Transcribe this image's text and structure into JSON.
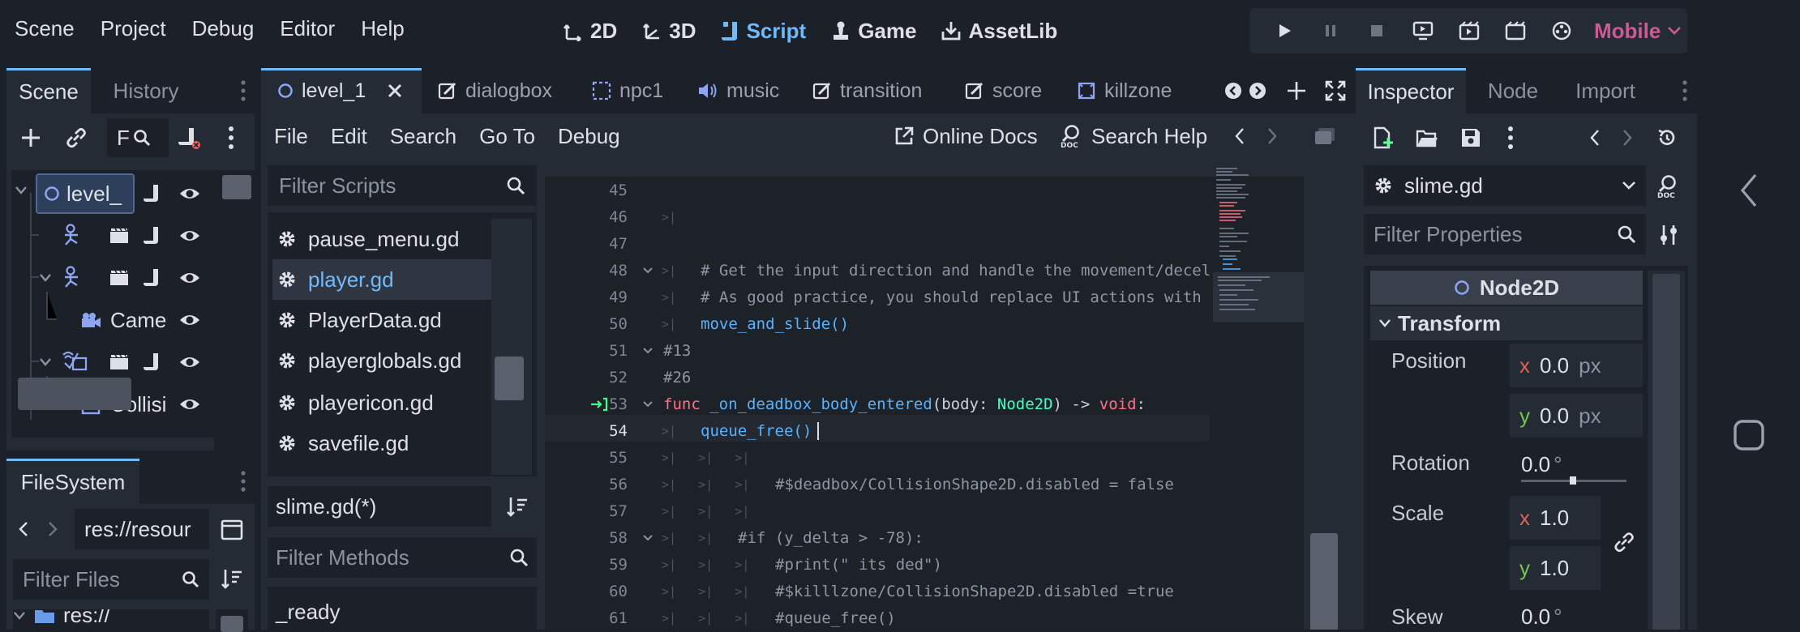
{
  "menu": {
    "items": [
      "Scene",
      "Project",
      "Debug",
      "Editor",
      "Help"
    ]
  },
  "workspaces": [
    {
      "label": "2D",
      "icon": "2d-icon"
    },
    {
      "label": "3D",
      "icon": "3d-icon"
    },
    {
      "label": "Script",
      "icon": "script-icon",
      "active": true
    },
    {
      "label": "Game",
      "icon": "game-icon"
    },
    {
      "label": "AssetLib",
      "icon": "assetlib-icon"
    }
  ],
  "renderer": "Mobile",
  "colors": {
    "accent": "#70bafa",
    "renderer": "#cc5a97",
    "keyword": "#ff7085",
    "function": "#57b3ff",
    "type": "#42ffc2",
    "comment": "#8e96a3"
  },
  "scene_dock": {
    "tabs": [
      "Scene",
      "History"
    ],
    "filter_placeholder": "F",
    "tree": [
      {
        "label": "level_",
        "icon": "node2d-icon",
        "selected": true
      },
      {
        "label": "",
        "icon": "characterbody-icon"
      },
      {
        "label": "",
        "icon": "characterbody-icon"
      },
      {
        "label": "Came",
        "icon": "camera-icon"
      },
      {
        "label": "",
        "icon": "area2d-icon"
      },
      {
        "label": "Collisi",
        "icon": "collision-icon"
      }
    ]
  },
  "filesystem": {
    "title": "FileSystem",
    "path": "res://resour",
    "filter_placeholder": "Filter Files",
    "root": "res://"
  },
  "editor_tabs": [
    "level_1",
    "dialogbox",
    "npc1",
    "music",
    "transition",
    "score",
    "killzone"
  ],
  "script_menu": [
    "File",
    "Edit",
    "Search",
    "Go To",
    "Debug"
  ],
  "online_docs": "Online Docs",
  "search_help": "Search Help",
  "script_list": {
    "filter_placeholder": "Filter Scripts",
    "items": [
      "pause_menu.gd",
      "player.gd",
      "PlayerData.gd",
      "playerglobals.gd",
      "playericon.gd",
      "savefile.gd"
    ],
    "current": "slime.gd(*)",
    "methods_placeholder": "Filter Methods",
    "methods": [
      "_ready"
    ]
  },
  "code": {
    "lines": [
      {
        "n": "45",
        "text": ""
      },
      {
        "n": "46",
        "text": ""
      },
      {
        "n": "47",
        "text": ""
      },
      {
        "n": "48",
        "text": "# Get the input direction and handle the movement/decel"
      },
      {
        "n": "49",
        "text": "# As good practice, you should replace UI actions with"
      },
      {
        "n": "50",
        "text": "move_and_slide()"
      },
      {
        "n": "51",
        "text": "#13"
      },
      {
        "n": "52",
        "text": "#26"
      },
      {
        "n": "53",
        "text": "func _on_deadbox_body_entered(body: Node2D) -> void:"
      },
      {
        "n": "54",
        "text": "queue_free()"
      },
      {
        "n": "55",
        "text": ""
      },
      {
        "n": "56",
        "text": "#$deadbox/CollisionShape2D.disabled = false"
      },
      {
        "n": "57",
        "text": ""
      },
      {
        "n": "58",
        "text": "#if (y_delta > -78):"
      },
      {
        "n": "59",
        "text": "#print(\" its ded\")"
      },
      {
        "n": "60",
        "text": "#$killlzone/CollisionShape2D.disabled =true"
      },
      {
        "n": "61",
        "text": "#queue_free()"
      }
    ]
  },
  "inspector": {
    "tabs": [
      "Inspector",
      "Node",
      "Import"
    ],
    "resource": "slime.gd",
    "filter_placeholder": "Filter Properties",
    "class_name": "Node2D",
    "section": "Transform",
    "position_label": "Position",
    "position_x": "0.0",
    "position_y": "0.0",
    "unit_px": "px",
    "rotation_label": "Rotation",
    "rotation": "0.0",
    "degree": "°",
    "scale_label": "Scale",
    "scale_x": "1.0",
    "scale_y": "1.0",
    "skew_label": "Skew",
    "skew": "0.0",
    "x": "x",
    "y": "y"
  }
}
